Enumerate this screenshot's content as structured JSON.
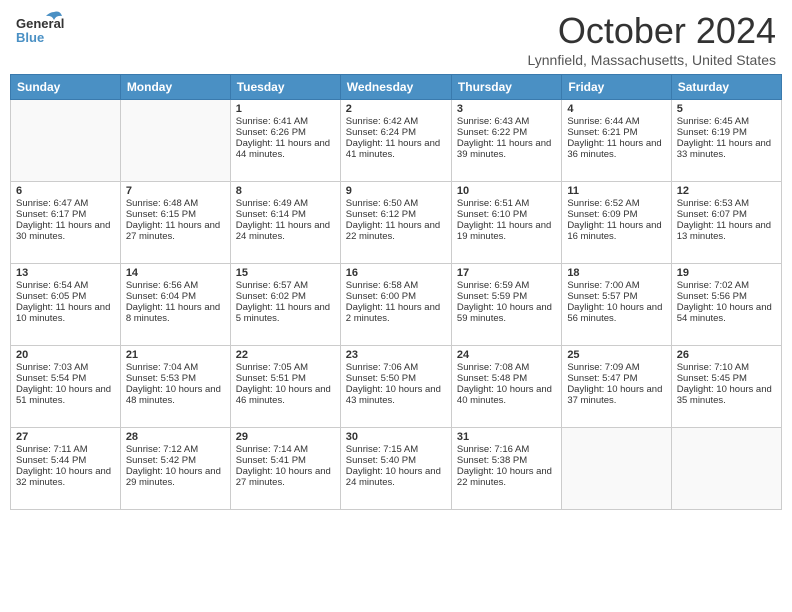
{
  "header": {
    "logo_general": "General",
    "logo_blue": "Blue",
    "month_title": "October 2024",
    "location": "Lynnfield, Massachusetts, United States"
  },
  "days_of_week": [
    "Sunday",
    "Monday",
    "Tuesday",
    "Wednesday",
    "Thursday",
    "Friday",
    "Saturday"
  ],
  "weeks": [
    [
      {
        "day": "",
        "empty": true
      },
      {
        "day": "",
        "empty": true
      },
      {
        "day": "1",
        "sunrise": "Sunrise: 6:41 AM",
        "sunset": "Sunset: 6:26 PM",
        "daylight": "Daylight: 11 hours and 44 minutes."
      },
      {
        "day": "2",
        "sunrise": "Sunrise: 6:42 AM",
        "sunset": "Sunset: 6:24 PM",
        "daylight": "Daylight: 11 hours and 41 minutes."
      },
      {
        "day": "3",
        "sunrise": "Sunrise: 6:43 AM",
        "sunset": "Sunset: 6:22 PM",
        "daylight": "Daylight: 11 hours and 39 minutes."
      },
      {
        "day": "4",
        "sunrise": "Sunrise: 6:44 AM",
        "sunset": "Sunset: 6:21 PM",
        "daylight": "Daylight: 11 hours and 36 minutes."
      },
      {
        "day": "5",
        "sunrise": "Sunrise: 6:45 AM",
        "sunset": "Sunset: 6:19 PM",
        "daylight": "Daylight: 11 hours and 33 minutes."
      }
    ],
    [
      {
        "day": "6",
        "sunrise": "Sunrise: 6:47 AM",
        "sunset": "Sunset: 6:17 PM",
        "daylight": "Daylight: 11 hours and 30 minutes."
      },
      {
        "day": "7",
        "sunrise": "Sunrise: 6:48 AM",
        "sunset": "Sunset: 6:15 PM",
        "daylight": "Daylight: 11 hours and 27 minutes."
      },
      {
        "day": "8",
        "sunrise": "Sunrise: 6:49 AM",
        "sunset": "Sunset: 6:14 PM",
        "daylight": "Daylight: 11 hours and 24 minutes."
      },
      {
        "day": "9",
        "sunrise": "Sunrise: 6:50 AM",
        "sunset": "Sunset: 6:12 PM",
        "daylight": "Daylight: 11 hours and 22 minutes."
      },
      {
        "day": "10",
        "sunrise": "Sunrise: 6:51 AM",
        "sunset": "Sunset: 6:10 PM",
        "daylight": "Daylight: 11 hours and 19 minutes."
      },
      {
        "day": "11",
        "sunrise": "Sunrise: 6:52 AM",
        "sunset": "Sunset: 6:09 PM",
        "daylight": "Daylight: 11 hours and 16 minutes."
      },
      {
        "day": "12",
        "sunrise": "Sunrise: 6:53 AM",
        "sunset": "Sunset: 6:07 PM",
        "daylight": "Daylight: 11 hours and 13 minutes."
      }
    ],
    [
      {
        "day": "13",
        "sunrise": "Sunrise: 6:54 AM",
        "sunset": "Sunset: 6:05 PM",
        "daylight": "Daylight: 11 hours and 10 minutes."
      },
      {
        "day": "14",
        "sunrise": "Sunrise: 6:56 AM",
        "sunset": "Sunset: 6:04 PM",
        "daylight": "Daylight: 11 hours and 8 minutes."
      },
      {
        "day": "15",
        "sunrise": "Sunrise: 6:57 AM",
        "sunset": "Sunset: 6:02 PM",
        "daylight": "Daylight: 11 hours and 5 minutes."
      },
      {
        "day": "16",
        "sunrise": "Sunrise: 6:58 AM",
        "sunset": "Sunset: 6:00 PM",
        "daylight": "Daylight: 11 hours and 2 minutes."
      },
      {
        "day": "17",
        "sunrise": "Sunrise: 6:59 AM",
        "sunset": "Sunset: 5:59 PM",
        "daylight": "Daylight: 10 hours and 59 minutes."
      },
      {
        "day": "18",
        "sunrise": "Sunrise: 7:00 AM",
        "sunset": "Sunset: 5:57 PM",
        "daylight": "Daylight: 10 hours and 56 minutes."
      },
      {
        "day": "19",
        "sunrise": "Sunrise: 7:02 AM",
        "sunset": "Sunset: 5:56 PM",
        "daylight": "Daylight: 10 hours and 54 minutes."
      }
    ],
    [
      {
        "day": "20",
        "sunrise": "Sunrise: 7:03 AM",
        "sunset": "Sunset: 5:54 PM",
        "daylight": "Daylight: 10 hours and 51 minutes."
      },
      {
        "day": "21",
        "sunrise": "Sunrise: 7:04 AM",
        "sunset": "Sunset: 5:53 PM",
        "daylight": "Daylight: 10 hours and 48 minutes."
      },
      {
        "day": "22",
        "sunrise": "Sunrise: 7:05 AM",
        "sunset": "Sunset: 5:51 PM",
        "daylight": "Daylight: 10 hours and 46 minutes."
      },
      {
        "day": "23",
        "sunrise": "Sunrise: 7:06 AM",
        "sunset": "Sunset: 5:50 PM",
        "daylight": "Daylight: 10 hours and 43 minutes."
      },
      {
        "day": "24",
        "sunrise": "Sunrise: 7:08 AM",
        "sunset": "Sunset: 5:48 PM",
        "daylight": "Daylight: 10 hours and 40 minutes."
      },
      {
        "day": "25",
        "sunrise": "Sunrise: 7:09 AM",
        "sunset": "Sunset: 5:47 PM",
        "daylight": "Daylight: 10 hours and 37 minutes."
      },
      {
        "day": "26",
        "sunrise": "Sunrise: 7:10 AM",
        "sunset": "Sunset: 5:45 PM",
        "daylight": "Daylight: 10 hours and 35 minutes."
      }
    ],
    [
      {
        "day": "27",
        "sunrise": "Sunrise: 7:11 AM",
        "sunset": "Sunset: 5:44 PM",
        "daylight": "Daylight: 10 hours and 32 minutes."
      },
      {
        "day": "28",
        "sunrise": "Sunrise: 7:12 AM",
        "sunset": "Sunset: 5:42 PM",
        "daylight": "Daylight: 10 hours and 29 minutes."
      },
      {
        "day": "29",
        "sunrise": "Sunrise: 7:14 AM",
        "sunset": "Sunset: 5:41 PM",
        "daylight": "Daylight: 10 hours and 27 minutes."
      },
      {
        "day": "30",
        "sunrise": "Sunrise: 7:15 AM",
        "sunset": "Sunset: 5:40 PM",
        "daylight": "Daylight: 10 hours and 24 minutes."
      },
      {
        "day": "31",
        "sunrise": "Sunrise: 7:16 AM",
        "sunset": "Sunset: 5:38 PM",
        "daylight": "Daylight: 10 hours and 22 minutes."
      },
      {
        "day": "",
        "empty": true
      },
      {
        "day": "",
        "empty": true
      }
    ]
  ]
}
